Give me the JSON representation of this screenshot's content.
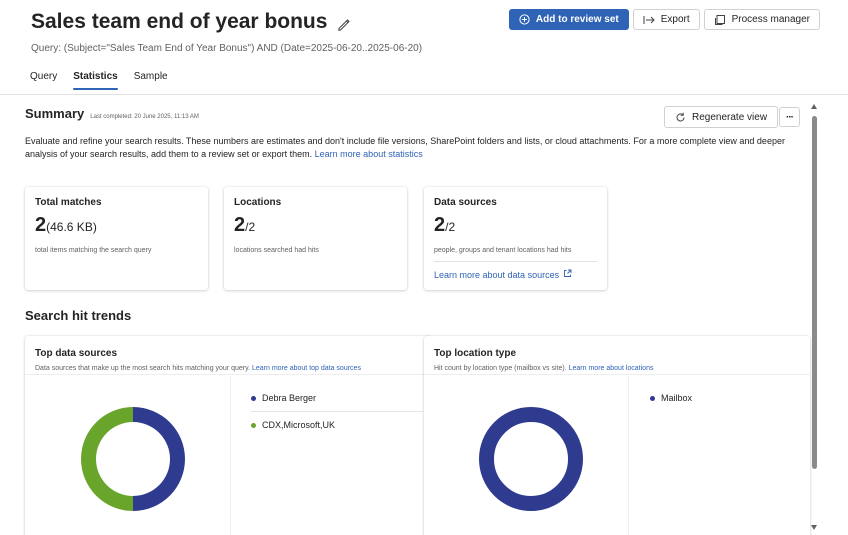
{
  "header": {
    "title": "Sales team end of year bonus",
    "query": "Query: (Subject=\"Sales Team End of Year Bonus\") AND (Date=2025-06-20..2025-06-20)",
    "actions": {
      "add_to_review_set": "Add to review set",
      "export": "Export",
      "process_manager": "Process manager"
    }
  },
  "tabs": [
    {
      "label": "Query",
      "active": false
    },
    {
      "label": "Statistics",
      "active": true
    },
    {
      "label": "Sample",
      "active": false
    }
  ],
  "summary": {
    "title": "Summary",
    "last_completed": "Last completed: 20 June 2025, 11:13 AM",
    "regenerate_label": "Regenerate view",
    "more_label": "···",
    "description": "Evaluate and refine your search results. These numbers are estimates and don't include file versions, SharePoint folders and lists, or cloud attachments. For a more complete view and deeper analysis of your search results, add them to a review set or export them.",
    "learn_more": "Learn more about statistics"
  },
  "cards": {
    "total_matches": {
      "label": "Total matches",
      "value": "2",
      "sub": "(46.6 KB)",
      "caption": "total items matching the search query"
    },
    "locations": {
      "label": "Locations",
      "value": "2",
      "sub": "/2",
      "caption": "locations searched had hits"
    },
    "data_sources": {
      "label": "Data sources",
      "value": "2",
      "sub": "/2",
      "caption": "people, groups and tenant locations had hits",
      "link": "Learn more about data sources"
    }
  },
  "trends": {
    "title": "Search hit trends",
    "top_data_sources": {
      "title": "Top data sources",
      "description": "Data sources that make up the most search hits matching your query.",
      "link": "Learn more about top data sources",
      "legend": [
        {
          "name": "Debra Berger",
          "color": "#2e3b8f"
        },
        {
          "name": "CDX,Microsoft,UK",
          "color": "#6aa52b"
        }
      ]
    },
    "top_location_type": {
      "title": "Top location type",
      "description": "Hit count by location type (mailbox vs site).",
      "link": "Learn more about locations",
      "legend": [
        {
          "name": "Mailbox",
          "color": "#2e3b8f"
        }
      ]
    }
  },
  "chart_data": [
    {
      "type": "pie",
      "categories": [
        "Debra Berger",
        "CDX,Microsoft,UK"
      ],
      "values": [
        1,
        1
      ],
      "colors": [
        "#2e3b8f",
        "#6aa52b"
      ],
      "title": "Top data sources"
    },
    {
      "type": "pie",
      "categories": [
        "Mailbox"
      ],
      "values": [
        2
      ],
      "colors": [
        "#2e3b8f"
      ],
      "title": "Top location type"
    }
  ]
}
